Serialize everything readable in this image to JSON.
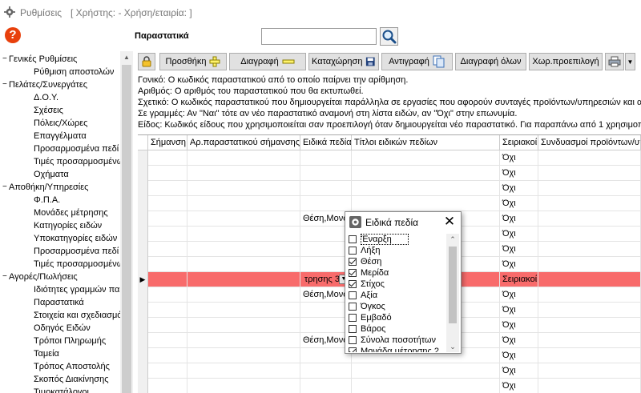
{
  "window": {
    "title": "Ρυθμίσεις",
    "context": "[ Χρήστης: - Χρήση/εταιρία: ]"
  },
  "help_label": "?",
  "form_title": "Παραστατικά",
  "search": {
    "value": "",
    "placeholder": ""
  },
  "tree": [
    {
      "label": "Γενικές Ρυθμίσεις",
      "level": 0,
      "expander": "−"
    },
    {
      "label": "Ρύθμιση αποστολών",
      "level": 1
    },
    {
      "label": "Πελάτες/Συνεργάτες",
      "level": 0,
      "expander": "−"
    },
    {
      "label": "Δ.Ο.Υ.",
      "level": 1
    },
    {
      "label": "Σχέσεις",
      "level": 1
    },
    {
      "label": "Πόλεις/Χώρες",
      "level": 1
    },
    {
      "label": "Επαγγέλματα",
      "level": 1
    },
    {
      "label": "Προσαρμοσμένα πεδί",
      "level": 1
    },
    {
      "label": "Τιμές προσαρμοσμένω",
      "level": 1
    },
    {
      "label": "Οχήματα",
      "level": 1
    },
    {
      "label": "Αποθήκη/Υπηρεσίες",
      "level": 0,
      "expander": "−"
    },
    {
      "label": "Φ.Π.Α.",
      "level": 1
    },
    {
      "label": "Μονάδες μέτρησης",
      "level": 1
    },
    {
      "label": "Κατηγορίες ειδών",
      "level": 1
    },
    {
      "label": "Υποκατηγορίες ειδών",
      "level": 1
    },
    {
      "label": "Προσαρμοσμένα πεδί",
      "level": 1
    },
    {
      "label": "Τιμές προσαρμοσμένω",
      "level": 1
    },
    {
      "label": "Αγορές/Πωλήσεις",
      "level": 0,
      "expander": "−"
    },
    {
      "label": "Ιδιότητες γραμμών πα",
      "level": 1
    },
    {
      "label": "Παραστατικά",
      "level": 1
    },
    {
      "label": "Στοιχεία και σχεδιασμό",
      "level": 1
    },
    {
      "label": "Οδηγός Ειδών",
      "level": 1
    },
    {
      "label": "Τρόποι Πληρωμής",
      "level": 1
    },
    {
      "label": "Ταμεία",
      "level": 1
    },
    {
      "label": "Τρόπος Αποστολής",
      "level": 1
    },
    {
      "label": "Σκοπός Διακίνησης",
      "level": 1
    },
    {
      "label": "Τιμοκατάλογοι",
      "level": 1
    }
  ],
  "toolbar": {
    "add": "Προσθήκη",
    "delete": "Διαγραφή",
    "save": "Καταχώρηση",
    "copy": "Αντιγραφή",
    "delete_all": "Διαγραφή όλων",
    "default_location": "Χωρ.προεπιλογή"
  },
  "info_lines": [
    "Γονικό: Ο κωδικός παραστατικού από το οποίο παίρνει την αρίθμηση.",
    "Αριθμός: Ο αριθμός του παραστατικού που θα εκτυπωθεί.",
    "Σχετικό: Ο κωδικός παραστατικού που δημιουργείται παράλληλα σε εργασίες που αφορούν συνταγές προϊόντων/υπηρεσιών και α",
    "Σε γραμμές: Αν \"Ναι\" τότε αν νέο παραστατικό αναμονή στη λίστα ειδών, αν \"Όχι\" στην επωνυμία.",
    "Είδος: Κωδικός είδους που χρησιμοποιείται σαν προεπιλογή όταν δημιουργείται νέο παραστατικό. Για παραπάνω από 1 χρησιμοπ"
  ],
  "grid": {
    "columns": [
      "Σήμανση",
      "Αρ.παραστατικού σήμανσης",
      "Ειδικά πεδία",
      "Τίτλοι ειδικών πεδίων",
      "Σειριακοί",
      "Συνδυασμοί προϊόντων/υπ"
    ],
    "rows": [
      {
        "special": "",
        "serial": "Όχι"
      },
      {
        "special": "",
        "serial": "Όχι"
      },
      {
        "special": "",
        "serial": "Όχι"
      },
      {
        "special": "",
        "serial": "Όχι"
      },
      {
        "special": "Θέση,Μονά",
        "serial": "Όχι"
      },
      {
        "special": "",
        "serial": "Όχι"
      },
      {
        "special": "",
        "serial": "Όχι"
      },
      {
        "special": "",
        "serial": "Όχι"
      },
      {
        "special": "τρησης 3",
        "serial": "Σειριακοί"
      },
      {
        "special": "Θέση,Μονά",
        "serial": "Όχι"
      },
      {
        "special": "",
        "serial": "Όχι"
      },
      {
        "special": "",
        "serial": "Όχι"
      },
      {
        "special": "Θέση,Μονά",
        "serial": "Όχι"
      },
      {
        "special": "",
        "serial": "Όχι"
      },
      {
        "special": "",
        "serial": "Όχι"
      },
      {
        "special": "",
        "serial": "Όχι"
      }
    ],
    "active_row_marker": "▶"
  },
  "popup": {
    "title": "Ειδικά πεδία",
    "close": "✕",
    "items": [
      {
        "label": "Έναρξη",
        "checked": false,
        "focus": true
      },
      {
        "label": "Λήξη",
        "checked": false
      },
      {
        "label": "Θέση",
        "checked": true
      },
      {
        "label": "Μερίδα",
        "checked": true
      },
      {
        "label": "Στίχος",
        "checked": true
      },
      {
        "label": "Αξία",
        "checked": false
      },
      {
        "label": "Όγκος",
        "checked": false
      },
      {
        "label": "Εμβαδό",
        "checked": false
      },
      {
        "label": "Βάρος",
        "checked": false
      },
      {
        "label": "Σύνολα ποσοτήτων",
        "checked": false
      },
      {
        "label": "Μονάδα μέτρησης 2",
        "checked": true
      }
    ]
  },
  "colors": {
    "active_row": "#f86b6b",
    "help": "#e8400c"
  }
}
